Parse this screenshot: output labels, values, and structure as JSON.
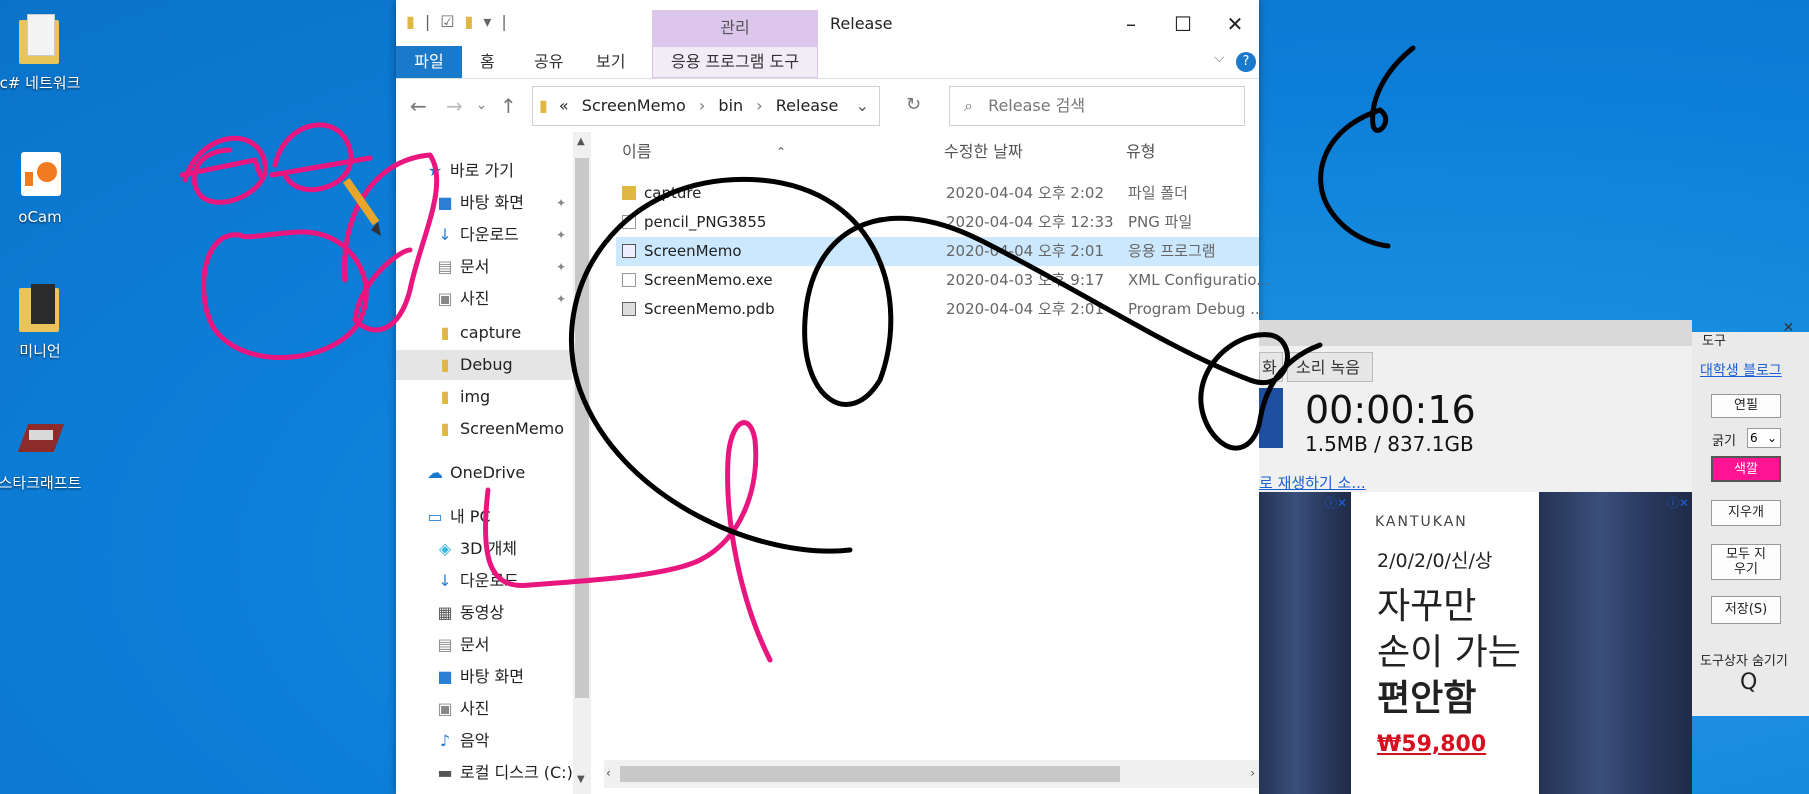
{
  "desktop": {
    "icons": [
      {
        "label": "c# 네트워크",
        "icon": "folder-icon"
      },
      {
        "label": "oCam",
        "icon": "ocam-icon"
      },
      {
        "label": "미니언",
        "icon": "folder-icon"
      },
      {
        "label": "스타크래프트",
        "icon": "starcraft-icon"
      }
    ]
  },
  "explorer": {
    "title": "Release",
    "manage_tab": "관리",
    "ribbon_tabs": [
      "파일",
      "홈",
      "공유",
      "보기"
    ],
    "app_tools": "응용 프로그램 도구",
    "breadcrumb": [
      "«",
      "ScreenMemo",
      "bin",
      "Release"
    ],
    "search_placeholder": "Release 검색",
    "nav": {
      "quick_access": "바로 가기",
      "items": [
        "바탕 화면",
        "다운로드",
        "문서",
        "사진",
        "capture",
        "Debug",
        "img",
        "ScreenMemo"
      ],
      "onedrive": "OneDrive",
      "this_pc": "내 PC",
      "pc_items": [
        "3D 개체",
        "다운로드",
        "동영상",
        "문서",
        "바탕 화면",
        "사진",
        "음악",
        "로컬 디스크 (C:)"
      ]
    },
    "columns": {
      "name": "이름",
      "date": "수정한 날짜",
      "type": "유형"
    },
    "files": [
      {
        "name": "capture",
        "date": "2020-04-04 오후 2:02",
        "type": "파일 폴더"
      },
      {
        "name": "pencil_PNG3855",
        "date": "2020-04-04 오후 12:33",
        "type": "PNG 파일"
      },
      {
        "name": "ScreenMemo",
        "date": "2020-04-04 오후 2:01",
        "type": "응용 프로그램"
      },
      {
        "name": "ScreenMemo.exe",
        "date": "2020-04-03 오후 9:17",
        "type": "XML Configuratio..."
      },
      {
        "name": "ScreenMemo.pdb",
        "date": "2020-04-04 오후 2:01",
        "type": "Program Debug ..."
      }
    ]
  },
  "recorder": {
    "tab_partial": "화",
    "tab_audio": "소리 녹음",
    "timer": "00:00:16",
    "size": "1.5MB / 837.1GB",
    "link": "로 재생하기 소..."
  },
  "ad": {
    "brand": "KANTUKAN",
    "new": "2/0/2/0/신/상",
    "line1": "자꾸만",
    "line2": "손이 가는",
    "line3": "편안함",
    "price": "₩59,800"
  },
  "toolbox": {
    "title": "도구",
    "blog_link": "대학생 블로그",
    "pen": "연필",
    "thickness_label": "굵기",
    "thickness_value": "6",
    "color": "색깔",
    "eraser": "지우개",
    "clear_all": "모두 지우기",
    "save": "저장(S)",
    "hide": "도구상자 숨기기",
    "hide_key": "Q"
  },
  "colors": {
    "ink_pink": "#e8167e",
    "ink_black": "#000000",
    "accent": "#1979ca",
    "color_btn": "#ff1493"
  }
}
